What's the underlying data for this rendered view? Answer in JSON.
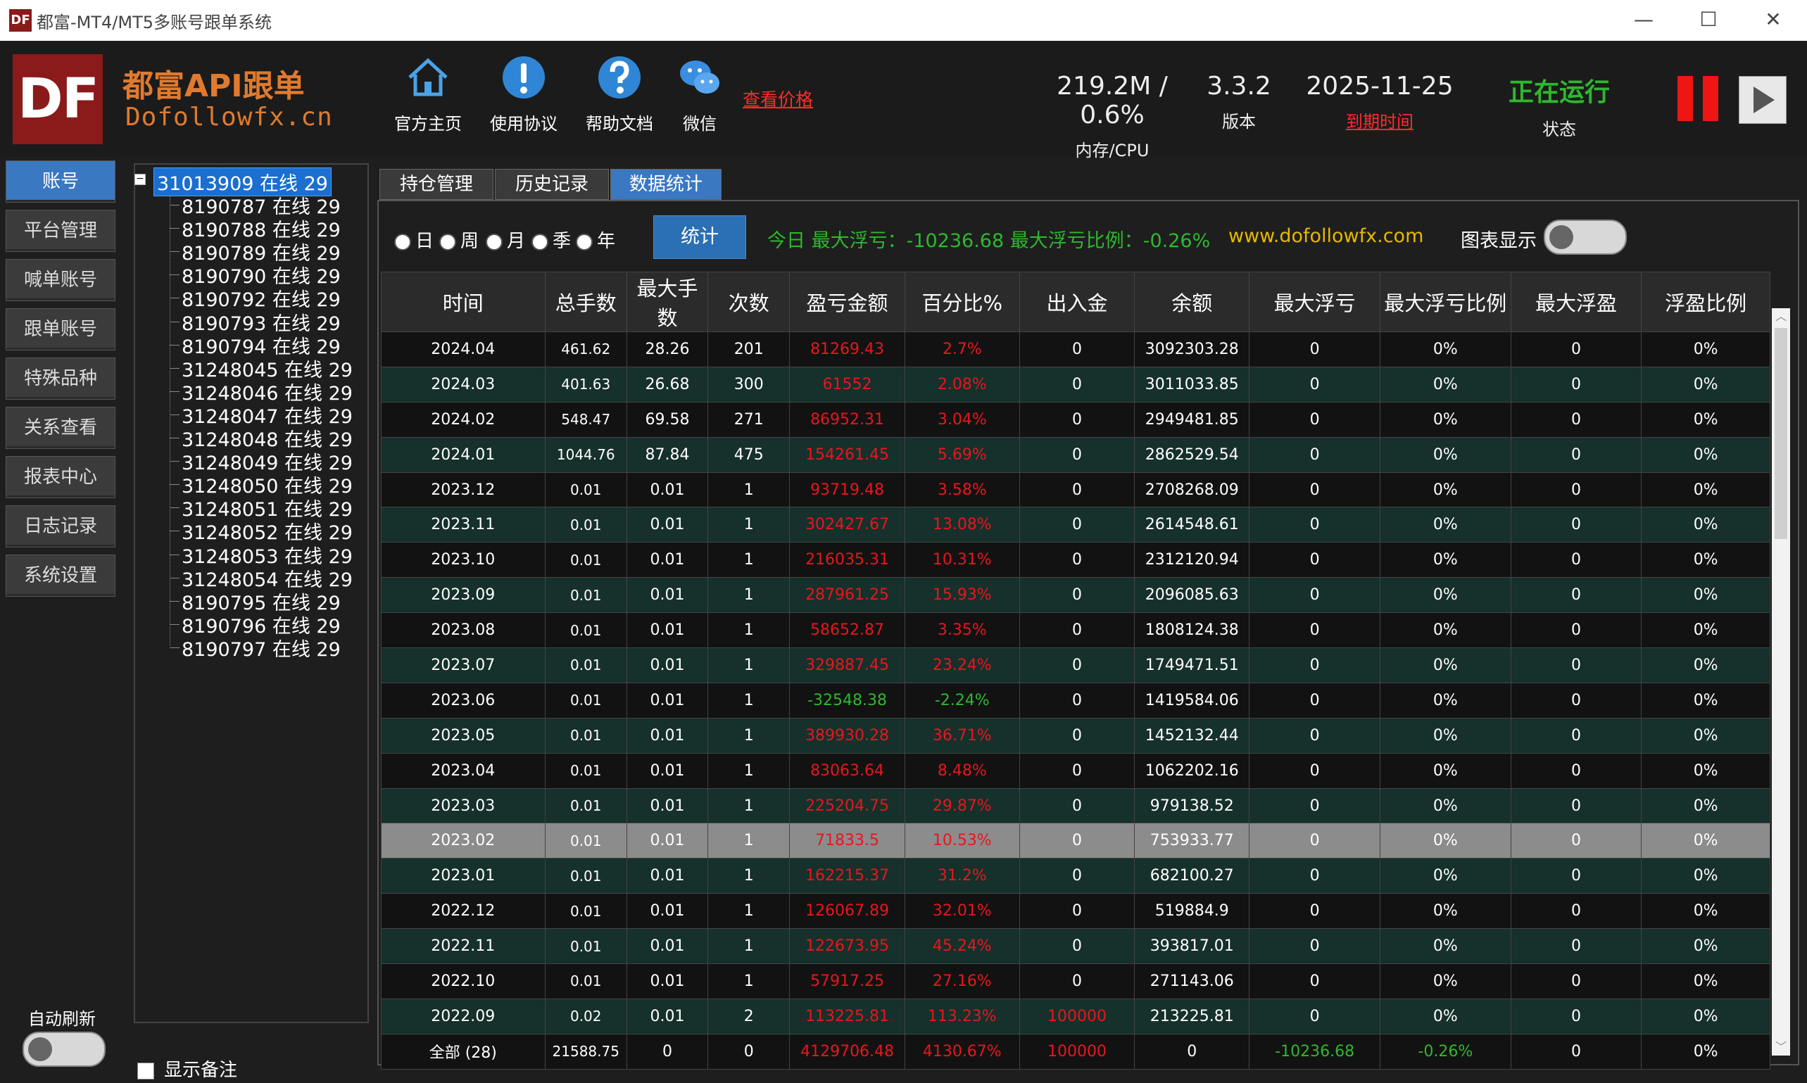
{
  "window": {
    "title": "都富-MT4/MT5多账号跟单系统",
    "logo_text": "DF",
    "minimize": "—",
    "maximize": "☐",
    "close": "✕"
  },
  "header": {
    "logo_text": "DF",
    "brand_name": "都富API跟单",
    "brand_url": "Dofollowfx.cn",
    "buttons": [
      {
        "label": "官方主页",
        "icon": "home-icon"
      },
      {
        "label": "使用协议",
        "icon": "exclamation-icon"
      },
      {
        "label": "帮助文档",
        "icon": "question-icon"
      },
      {
        "label": "微信",
        "icon": "wechat-icon"
      }
    ],
    "view_price": "查看价格",
    "memory_cpu": {
      "value": "219.2M / 0.6%",
      "label": "内存/CPU"
    },
    "version": {
      "value": "3.3.2",
      "label": "版本"
    },
    "expire": {
      "value": "2025-11-25",
      "label": "到期时间"
    },
    "status": {
      "value": "正在运行",
      "label": "状态"
    },
    "colors": {
      "accent_orange": "#e07a2e",
      "running_green": "#2eb82e",
      "stop_red": "#f01515"
    }
  },
  "sidebar": {
    "items": [
      {
        "label": "账号",
        "active": true
      },
      {
        "label": "平台管理"
      },
      {
        "label": "喊单账号"
      },
      {
        "label": "跟单账号"
      },
      {
        "label": "特殊品种"
      },
      {
        "label": "关系查看"
      },
      {
        "label": "报表中心"
      },
      {
        "label": "日志记录"
      },
      {
        "label": "系统设置"
      }
    ],
    "auto_refresh_label": "自动刷新"
  },
  "tree": {
    "root": "31013909 在线 29",
    "children": [
      "8190787 在线 29",
      "8190788 在线 29",
      "8190789 在线 29",
      "8190790 在线 29",
      "8190792 在线 29",
      "8190793 在线 29",
      "8190794 在线 29",
      "31248045 在线 29",
      "31248046 在线 29",
      "31248047 在线 29",
      "31248048 在线 29",
      "31248049 在线 29",
      "31248050 在线 29",
      "31248051 在线 29",
      "31248052 在线 29",
      "31248053 在线 29",
      "31248054 在线 29",
      "8190795 在线 29",
      "8190796 在线 29",
      "8190797 在线 29"
    ],
    "show_remark": "显示备注"
  },
  "tabs": [
    "持仓管理",
    "历史记录",
    "数据统计"
  ],
  "filter": {
    "periods": [
      "日",
      "周",
      "月",
      "季",
      "年"
    ],
    "stat_button": "统计",
    "today_info": "今日 最大浮亏：-10236.68  最大浮亏比例：-0.26%",
    "site_url": "www.dofollowfx.com",
    "chart_label": "图表显示"
  },
  "table": {
    "columns": [
      "时间",
      "总手数",
      "最大手数",
      "次数",
      "盈亏金额",
      "百分比%",
      "出入金",
      "余额",
      "最大浮亏",
      "最大浮亏比例",
      "最大浮盈",
      "浮盈比例"
    ],
    "rows": [
      [
        "2024.04",
        "461.62",
        "28.26",
        "201",
        "81269.43",
        "2.7%",
        "0",
        "3092303.28",
        "0",
        "0%",
        "0",
        "0%"
      ],
      [
        "2024.03",
        "401.63",
        "26.68",
        "300",
        "61552",
        "2.08%",
        "0",
        "3011033.85",
        "0",
        "0%",
        "0",
        "0%"
      ],
      [
        "2024.02",
        "548.47",
        "69.58",
        "271",
        "86952.31",
        "3.04%",
        "0",
        "2949481.85",
        "0",
        "0%",
        "0",
        "0%"
      ],
      [
        "2024.01",
        "1044.76",
        "87.84",
        "475",
        "154261.45",
        "5.69%",
        "0",
        "2862529.54",
        "0",
        "0%",
        "0",
        "0%"
      ],
      [
        "2023.12",
        "0.01",
        "0.01",
        "1",
        "93719.48",
        "3.58%",
        "0",
        "2708268.09",
        "0",
        "0%",
        "0",
        "0%"
      ],
      [
        "2023.11",
        "0.01",
        "0.01",
        "1",
        "302427.67",
        "13.08%",
        "0",
        "2614548.61",
        "0",
        "0%",
        "0",
        "0%"
      ],
      [
        "2023.10",
        "0.01",
        "0.01",
        "1",
        "216035.31",
        "10.31%",
        "0",
        "2312120.94",
        "0",
        "0%",
        "0",
        "0%"
      ],
      [
        "2023.09",
        "0.01",
        "0.01",
        "1",
        "287961.25",
        "15.93%",
        "0",
        "2096085.63",
        "0",
        "0%",
        "0",
        "0%"
      ],
      [
        "2023.08",
        "0.01",
        "0.01",
        "1",
        "58652.87",
        "3.35%",
        "0",
        "1808124.38",
        "0",
        "0%",
        "0",
        "0%"
      ],
      [
        "2023.07",
        "0.01",
        "0.01",
        "1",
        "329887.45",
        "23.24%",
        "0",
        "1749471.51",
        "0",
        "0%",
        "0",
        "0%"
      ],
      [
        "2023.06",
        "0.01",
        "0.01",
        "1",
        "-32548.38",
        "-2.24%",
        "0",
        "1419584.06",
        "0",
        "0%",
        "0",
        "0%"
      ],
      [
        "2023.05",
        "0.01",
        "0.01",
        "1",
        "389930.28",
        "36.71%",
        "0",
        "1452132.44",
        "0",
        "0%",
        "0",
        "0%"
      ],
      [
        "2023.04",
        "0.01",
        "0.01",
        "1",
        "83063.64",
        "8.48%",
        "0",
        "1062202.16",
        "0",
        "0%",
        "0",
        "0%"
      ],
      [
        "2023.03",
        "0.01",
        "0.01",
        "1",
        "225204.75",
        "29.87%",
        "0",
        "979138.52",
        "0",
        "0%",
        "0",
        "0%"
      ],
      [
        "2023.02",
        "0.01",
        "0.01",
        "1",
        "71833.5",
        "10.53%",
        "0",
        "753933.77",
        "0",
        "0%",
        "0",
        "0%"
      ],
      [
        "2023.01",
        "0.01",
        "0.01",
        "1",
        "162215.37",
        "31.2%",
        "0",
        "682100.27",
        "0",
        "0%",
        "0",
        "0%"
      ],
      [
        "2022.12",
        "0.01",
        "0.01",
        "1",
        "126067.89",
        "32.01%",
        "0",
        "519884.9",
        "0",
        "0%",
        "0",
        "0%"
      ],
      [
        "2022.11",
        "0.01",
        "0.01",
        "1",
        "122673.95",
        "45.24%",
        "0",
        "393817.01",
        "0",
        "0%",
        "0",
        "0%"
      ],
      [
        "2022.10",
        "0.01",
        "0.01",
        "1",
        "57917.25",
        "27.16%",
        "0",
        "271143.06",
        "0",
        "0%",
        "0",
        "0%"
      ],
      [
        "2022.09",
        "0.02",
        "0.01",
        "2",
        "113225.81",
        "113.23%",
        "100000",
        "213225.81",
        "0",
        "0%",
        "0",
        "0%"
      ],
      [
        "全部 (28)",
        "21588.75",
        "0",
        "0",
        "4129706.48",
        "4130.67%",
        "100000",
        "0",
        "-10236.68",
        "-0.26%",
        "0",
        "0%"
      ]
    ],
    "selected_row": "2023.02",
    "colors": {
      "profit": "#e8161c",
      "loss": "#2eb82e",
      "row_alt": "#16302b",
      "selected": "#8c8c8c"
    }
  }
}
